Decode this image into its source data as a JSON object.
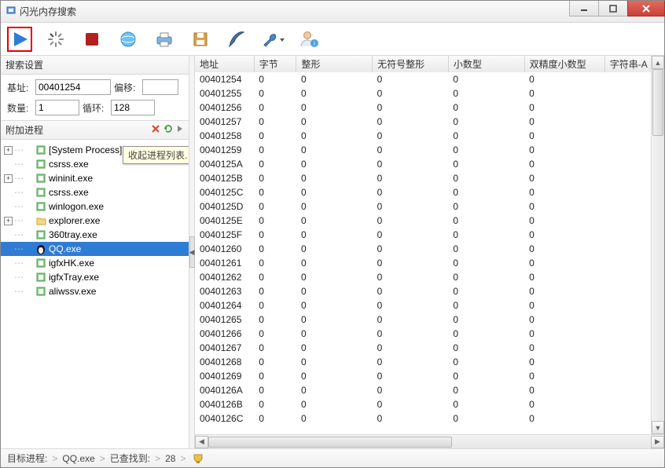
{
  "window": {
    "title": "闪光内存搜索"
  },
  "toolbar": {
    "icons": [
      "play",
      "spinner",
      "stop",
      "globe",
      "printer",
      "save",
      "feather",
      "wrench",
      "user-help"
    ]
  },
  "search_panel": {
    "title": "搜索设置",
    "base_label": "基址:",
    "base_value": "00401254",
    "offset_label": "偏移:",
    "offset_value": "",
    "qty_label": "数量:",
    "qty_value": "1",
    "loop_label": "循环:",
    "loop_value": "128"
  },
  "attach_panel": {
    "title": "附加进程",
    "tooltip": "收起进程列表.",
    "processes": [
      {
        "label": "[System Process]",
        "expandable": true,
        "icon": "square",
        "selected": false
      },
      {
        "label": "csrss.exe",
        "expandable": false,
        "icon": "square",
        "selected": false
      },
      {
        "label": "wininit.exe",
        "expandable": true,
        "icon": "square",
        "selected": false
      },
      {
        "label": "csrss.exe",
        "expandable": false,
        "icon": "square",
        "selected": false
      },
      {
        "label": "winlogon.exe",
        "expandable": false,
        "icon": "square",
        "selected": false
      },
      {
        "label": "explorer.exe",
        "expandable": true,
        "icon": "folder",
        "selected": false
      },
      {
        "label": "360tray.exe",
        "expandable": false,
        "icon": "square",
        "selected": false
      },
      {
        "label": "QQ.exe",
        "expandable": false,
        "icon": "penguin",
        "selected": true
      },
      {
        "label": "igfxHK.exe",
        "expandable": false,
        "icon": "square",
        "selected": false
      },
      {
        "label": "igfxTray.exe",
        "expandable": false,
        "icon": "square",
        "selected": false
      },
      {
        "label": "aliwssv.exe",
        "expandable": false,
        "icon": "square",
        "selected": false
      }
    ]
  },
  "grid": {
    "columns": [
      "地址",
      "字节",
      "整形",
      "无符号整形",
      "小数型",
      "双精度小数型",
      "字符串-A"
    ],
    "rows": [
      {
        "addr": "00401254",
        "b": "0",
        "i": "0",
        "u": "0",
        "f": "0",
        "d": "0",
        "s": ""
      },
      {
        "addr": "00401255",
        "b": "0",
        "i": "0",
        "u": "0",
        "f": "0",
        "d": "0",
        "s": ""
      },
      {
        "addr": "00401256",
        "b": "0",
        "i": "0",
        "u": "0",
        "f": "0",
        "d": "0",
        "s": ""
      },
      {
        "addr": "00401257",
        "b": "0",
        "i": "0",
        "u": "0",
        "f": "0",
        "d": "0",
        "s": ""
      },
      {
        "addr": "00401258",
        "b": "0",
        "i": "0",
        "u": "0",
        "f": "0",
        "d": "0",
        "s": ""
      },
      {
        "addr": "00401259",
        "b": "0",
        "i": "0",
        "u": "0",
        "f": "0",
        "d": "0",
        "s": ""
      },
      {
        "addr": "0040125A",
        "b": "0",
        "i": "0",
        "u": "0",
        "f": "0",
        "d": "0",
        "s": ""
      },
      {
        "addr": "0040125B",
        "b": "0",
        "i": "0",
        "u": "0",
        "f": "0",
        "d": "0",
        "s": ""
      },
      {
        "addr": "0040125C",
        "b": "0",
        "i": "0",
        "u": "0",
        "f": "0",
        "d": "0",
        "s": ""
      },
      {
        "addr": "0040125D",
        "b": "0",
        "i": "0",
        "u": "0",
        "f": "0",
        "d": "0",
        "s": ""
      },
      {
        "addr": "0040125E",
        "b": "0",
        "i": "0",
        "u": "0",
        "f": "0",
        "d": "0",
        "s": ""
      },
      {
        "addr": "0040125F",
        "b": "0",
        "i": "0",
        "u": "0",
        "f": "0",
        "d": "0",
        "s": ""
      },
      {
        "addr": "00401260",
        "b": "0",
        "i": "0",
        "u": "0",
        "f": "0",
        "d": "0",
        "s": ""
      },
      {
        "addr": "00401261",
        "b": "0",
        "i": "0",
        "u": "0",
        "f": "0",
        "d": "0",
        "s": ""
      },
      {
        "addr": "00401262",
        "b": "0",
        "i": "0",
        "u": "0",
        "f": "0",
        "d": "0",
        "s": ""
      },
      {
        "addr": "00401263",
        "b": "0",
        "i": "0",
        "u": "0",
        "f": "0",
        "d": "0",
        "s": ""
      },
      {
        "addr": "00401264",
        "b": "0",
        "i": "0",
        "u": "0",
        "f": "0",
        "d": "0",
        "s": ""
      },
      {
        "addr": "00401265",
        "b": "0",
        "i": "0",
        "u": "0",
        "f": "0",
        "d": "0",
        "s": ""
      },
      {
        "addr": "00401266",
        "b": "0",
        "i": "0",
        "u": "0",
        "f": "0",
        "d": "0",
        "s": ""
      },
      {
        "addr": "00401267",
        "b": "0",
        "i": "0",
        "u": "0",
        "f": "0",
        "d": "0",
        "s": ""
      },
      {
        "addr": "00401268",
        "b": "0",
        "i": "0",
        "u": "0",
        "f": "0",
        "d": "0",
        "s": ""
      },
      {
        "addr": "00401269",
        "b": "0",
        "i": "0",
        "u": "0",
        "f": "0",
        "d": "0",
        "s": ""
      },
      {
        "addr": "0040126A",
        "b": "0",
        "i": "0",
        "u": "0",
        "f": "0",
        "d": "0",
        "s": ""
      },
      {
        "addr": "0040126B",
        "b": "0",
        "i": "0",
        "u": "0",
        "f": "0",
        "d": "0",
        "s": ""
      },
      {
        "addr": "0040126C",
        "b": "0",
        "i": "0",
        "u": "0",
        "f": "0",
        "d": "0",
        "s": ""
      }
    ]
  },
  "status": {
    "label_target": "目标进程:",
    "target_value": "QQ.exe",
    "label_found": "已查找到:",
    "found_value": "28"
  }
}
